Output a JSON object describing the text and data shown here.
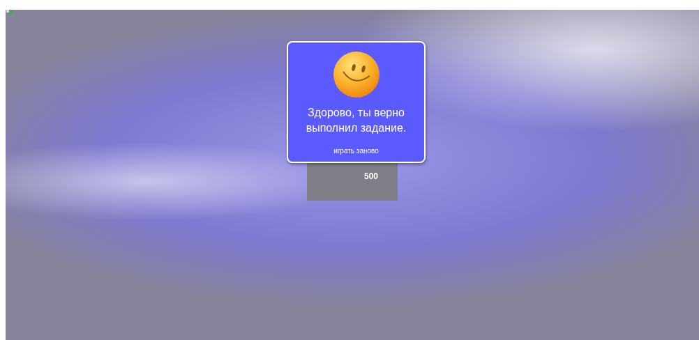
{
  "score_card": {
    "value": "500"
  },
  "popup": {
    "message": "Здорово, ты верно выполнил задание.",
    "replay_link": "играть заново"
  }
}
